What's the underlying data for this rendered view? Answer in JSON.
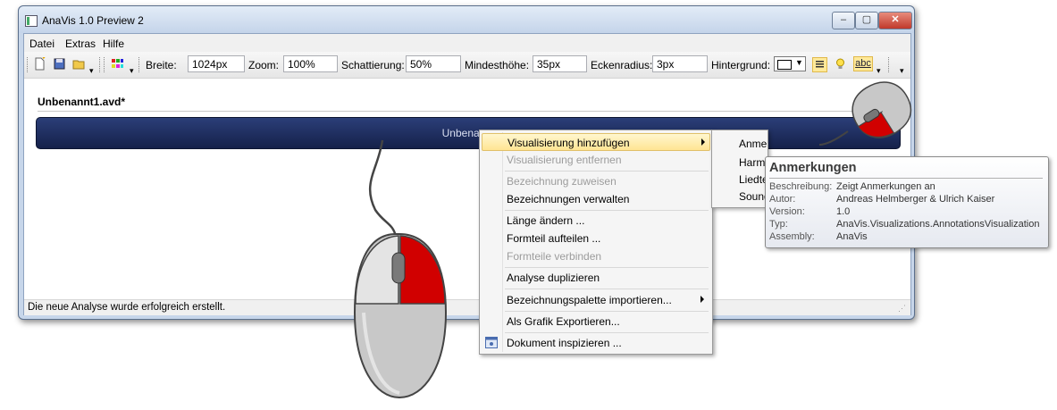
{
  "window": {
    "title": "AnaVis 1.0 Preview 2",
    "controls": [
      "‒",
      "▢",
      "✕"
    ]
  },
  "menubar": {
    "items": [
      "Datei",
      "Extras",
      "Hilfe"
    ]
  },
  "toolbar": {
    "breite_label": "Breite:",
    "breite_value": "1024px",
    "zoom_label": "Zoom:",
    "zoom_value": "100%",
    "schattierung_label": "Schattierung:",
    "schattierung_value": "50%",
    "mindesthoehe_label": "Mindesthöhe:",
    "mindesthoehe_value": "35px",
    "eckenradius_label": "Eckenradius:",
    "eckenradius_value": "3px",
    "hintergrund_label": "Hintergrund:",
    "abc_label": "abc",
    "icons": [
      "new-file-icon",
      "save-icon",
      "open-folder-icon",
      "palette-icon",
      "color-swatch-icon",
      "list-icon",
      "lightbulb-icon",
      "abc-icon"
    ]
  },
  "document": {
    "title": "Unbenannt1.avd*",
    "visualization_label": "Unbenannt"
  },
  "status": {
    "text": "Die neue Analyse wurde erfolgreich erstellt."
  },
  "context_menu": {
    "items": [
      {
        "label": "Visualisierung hinzufügen",
        "enabled": true,
        "submenu": true
      },
      {
        "label": "Visualisierung entfernen",
        "enabled": false
      },
      {
        "label": "Bezeichnung zuweisen",
        "enabled": false
      },
      {
        "label": "Bezeichnungen verwalten",
        "enabled": true
      },
      {
        "label": "Länge ändern ...",
        "enabled": true
      },
      {
        "label": "Formteil aufteilen ...",
        "enabled": true
      },
      {
        "label": "Formteile verbinden",
        "enabled": false
      },
      {
        "label": "Analyse duplizieren",
        "enabled": true
      },
      {
        "label": "Bezeichnungspalette importieren...",
        "enabled": true,
        "submenu": true
      },
      {
        "label": "Als Grafik Exportieren...",
        "enabled": true
      },
      {
        "label": "Dokument inspizieren ...",
        "enabled": true
      }
    ]
  },
  "submenu": {
    "items": [
      "Anmerkungen",
      "Harm",
      "Liedte",
      "Sound"
    ]
  },
  "tooltip": {
    "title": "Anmerkungen",
    "rows": [
      {
        "key": "Beschreibung:",
        "value": "Zeigt Anmerkungen an"
      },
      {
        "key": "Autor:",
        "value": "Andreas Helmberger & Ulrich Kaiser"
      },
      {
        "key": "Version:",
        "value": "1.0"
      },
      {
        "key": "Typ:",
        "value": "AnaVis.Visualizations.AnnotationsVisualization"
      },
      {
        "key": "Assembly:",
        "value": "AnaVis"
      }
    ]
  },
  "colors": {
    "highlight": "#ffe593",
    "vis_bar": "#1d2b5c",
    "mouse_right_button": "#cc0000"
  }
}
